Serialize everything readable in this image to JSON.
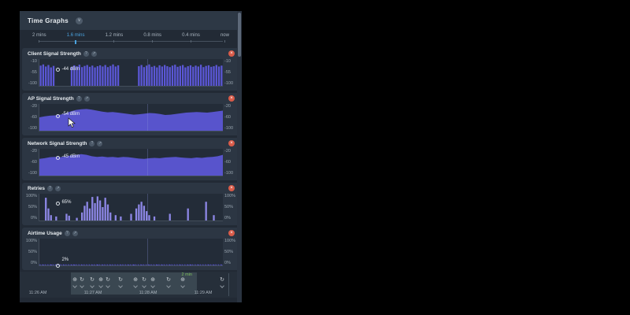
{
  "panel": {
    "title": "Time Graphs"
  },
  "icons": {
    "collapse": "∨",
    "help": "?",
    "popout": "↗",
    "close": "×",
    "refresh": "↻",
    "search": "⊕"
  },
  "tabs": {
    "items": [
      {
        "label": "2 mins",
        "active": false
      },
      {
        "label": "1.6 mins",
        "active": true
      },
      {
        "label": "1.2 mins",
        "active": false
      },
      {
        "label": "0.8 mins",
        "active": false
      },
      {
        "label": "0.4 mins",
        "active": false
      },
      {
        "label": "now",
        "active": false
      }
    ]
  },
  "colors": {
    "signal_purple": "#5b57d6",
    "retries_purple": "#8d87e6",
    "tab_active_blue": "#4aa3e0",
    "close_button_red": "#d85b49",
    "window_label_green": "#7ebf5e",
    "panel_bg": "#222a35",
    "card_bg": "#2c3643"
  },
  "chart_data": [
    {
      "type": "bar",
      "title": "Client Signal Strength",
      "ylabel": "dBm",
      "y_ticks": [
        "-10",
        "-55",
        "-100"
      ],
      "y_domain": [
        -10,
        -100
      ],
      "color": "#5b57d6",
      "tooltip": {
        "label": "-44 dBm",
        "value": -44,
        "x_frac": 0.105,
        "label_dy": -1
      },
      "values": [
        -32,
        -28,
        -35,
        -30,
        -38,
        -33,
        null,
        null,
        null,
        null,
        null,
        null,
        -36,
        -31,
        -34,
        -29,
        -37,
        -33,
        -30,
        -36,
        -32,
        -38,
        -34,
        -31,
        -35,
        -30,
        -37,
        -33,
        -28,
        -35,
        -31,
        null,
        null,
        null,
        null,
        null,
        null,
        null,
        -34,
        -30,
        -37,
        -32,
        -28,
        -36,
        -33,
        -38,
        -31,
        -35,
        -30,
        -34,
        -37,
        -32,
        -29,
        -36,
        -33,
        -30,
        -38,
        -34,
        -31,
        -36,
        -32,
        -35,
        -29,
        -37,
        -33,
        -31,
        -36,
        -34,
        -30,
        -35,
        -32
      ]
    },
    {
      "type": "area",
      "title": "AP Signal Strength",
      "ylabel": "dBm",
      "y_ticks": [
        "-20",
        "-60",
        "-100"
      ],
      "y_domain": [
        -20,
        -100
      ],
      "color": "#5b57d6",
      "tooltip": {
        "label": "-54 dBm",
        "value": -54,
        "x_frac": 0.105,
        "label_dy": -2
      },
      "values": [
        -60,
        -57,
        -55,
        -54,
        -52,
        -48,
        -42,
        -38,
        -36,
        -35,
        -37,
        -40,
        -43,
        -45,
        -44,
        -46,
        -48,
        -50,
        -52,
        -51,
        -49,
        -47,
        -48,
        -50,
        -53,
        -52,
        -50,
        -48,
        -46,
        -45,
        -44,
        -45,
        -46,
        -44,
        -42,
        -40
      ]
    },
    {
      "type": "area",
      "title": "Network Signal Strength",
      "ylabel": "dBm",
      "y_ticks": [
        "-20",
        "-60",
        "-100"
      ],
      "y_domain": [
        -20,
        -100
      ],
      "color": "#5b57d6",
      "tooltip": {
        "label": "-45 dBm",
        "value": -45,
        "x_frac": 0.105,
        "label_dy": -2
      },
      "values": [
        -50,
        -48,
        -45,
        -44,
        -45,
        -43,
        -40,
        -38,
        -36,
        -38,
        -42,
        -44,
        -43,
        -45,
        -44,
        -46,
        -44,
        -45,
        -47,
        -49,
        -50,
        -48,
        -47,
        -48,
        -46,
        -45,
        -44,
        -46,
        -47,
        -48,
        -46,
        -47,
        -45,
        -44,
        -42,
        -38
      ]
    },
    {
      "type": "bar",
      "title": "Retries",
      "ylabel": "%",
      "y_ticks": [
        "100%",
        "50%",
        "0%"
      ],
      "y_domain": [
        100,
        0
      ],
      "color": "#8d87e6",
      "tooltip": {
        "label": "65%",
        "value": 65,
        "x_frac": 0.105,
        "label_dy": -2
      },
      "values": [
        0,
        0,
        85,
        45,
        20,
        0,
        15,
        0,
        0,
        0,
        25,
        18,
        0,
        0,
        10,
        0,
        30,
        55,
        70,
        45,
        88,
        65,
        90,
        75,
        50,
        85,
        60,
        30,
        0,
        20,
        0,
        15,
        0,
        0,
        0,
        25,
        0,
        45,
        60,
        70,
        55,
        35,
        20,
        0,
        15,
        0,
        0,
        0,
        0,
        0,
        25,
        0,
        0,
        0,
        0,
        0,
        0,
        45,
        0,
        0,
        0,
        0,
        0,
        0,
        70,
        0,
        0,
        20,
        0,
        0,
        0
      ]
    },
    {
      "type": "bar",
      "title": "Airtime Usage",
      "ylabel": "%",
      "y_ticks": [
        "100%",
        "50%",
        "0%"
      ],
      "y_domain": [
        100,
        0
      ],
      "color": "#5b57d6",
      "baseline": true,
      "tooltip": {
        "label": "2%",
        "value": 2,
        "x_frac": 0.105,
        "label_dy": -7
      },
      "values": [
        1,
        2,
        1,
        1,
        3,
        1,
        2,
        1,
        1,
        2,
        1,
        1,
        2,
        3,
        1,
        1,
        2,
        1,
        1,
        1,
        2,
        1,
        3,
        1,
        2,
        1,
        1,
        2,
        1,
        1,
        1,
        2,
        1,
        1,
        2,
        1,
        3,
        1,
        1,
        2,
        1,
        1,
        2,
        1,
        1,
        3,
        1,
        2,
        1,
        1,
        2,
        1,
        1,
        1,
        2,
        1,
        1,
        2,
        3,
        1,
        1,
        2,
        1,
        1,
        1,
        2,
        1,
        2,
        1,
        1,
        2
      ]
    }
  ],
  "timeline": {
    "window_label": "2 min",
    "timestamps": [
      "11:26 AM",
      "11:27 AM",
      "11:28 AM",
      "11:29 AM"
    ],
    "timestamp_x": [
      23,
      93,
      163,
      233
    ],
    "events": [
      {
        "x": 70,
        "icon": "search"
      },
      {
        "x": 79,
        "icon": "refresh"
      },
      {
        "x": 92,
        "icon": "refresh"
      },
      {
        "x": 103,
        "icon": "search"
      },
      {
        "x": 112,
        "icon": "refresh"
      },
      {
        "x": 128,
        "icon": "refresh"
      },
      {
        "x": 147,
        "icon": "search"
      },
      {
        "x": 158,
        "icon": "refresh"
      },
      {
        "x": 169,
        "icon": "search"
      },
      {
        "x": 189,
        "icon": "refresh"
      },
      {
        "x": 207,
        "icon": "search"
      },
      {
        "x": 257,
        "icon": "refresh"
      }
    ]
  }
}
